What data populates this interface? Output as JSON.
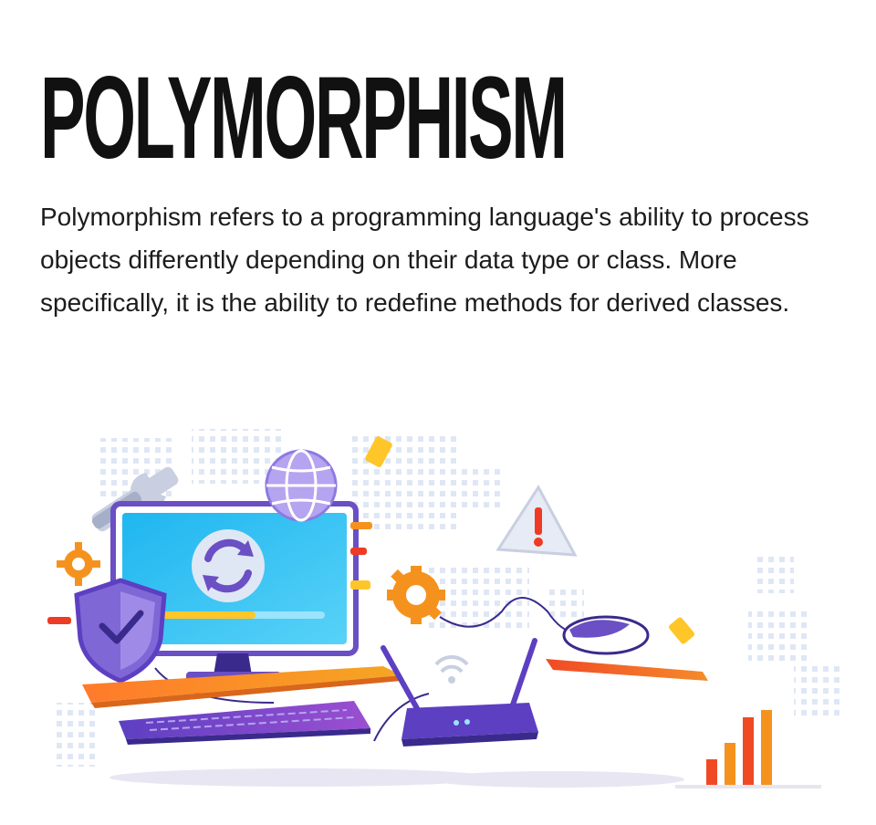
{
  "page": {
    "title": "POLYMORPHISM",
    "description": "Polymorphism refers to a programming language's ability to process objects differently depending on their data type or class. More specifically, it is the ability to redefine methods for derived classes."
  },
  "illustration": {
    "icons": [
      "wrench-icon",
      "globe-icon",
      "refresh-icon",
      "shield-check-icon",
      "gear-icon",
      "warning-icon",
      "mouse-icon",
      "router-icon",
      "keyboard-icon",
      "bar-chart-icon"
    ],
    "colors": {
      "screen": "#2ec0f2",
      "purple": "#6b4fc4",
      "orange": "#f5921e",
      "red": "#ee3b24",
      "yellow": "#ffc629",
      "light_blue": "#dfe7f5"
    }
  }
}
